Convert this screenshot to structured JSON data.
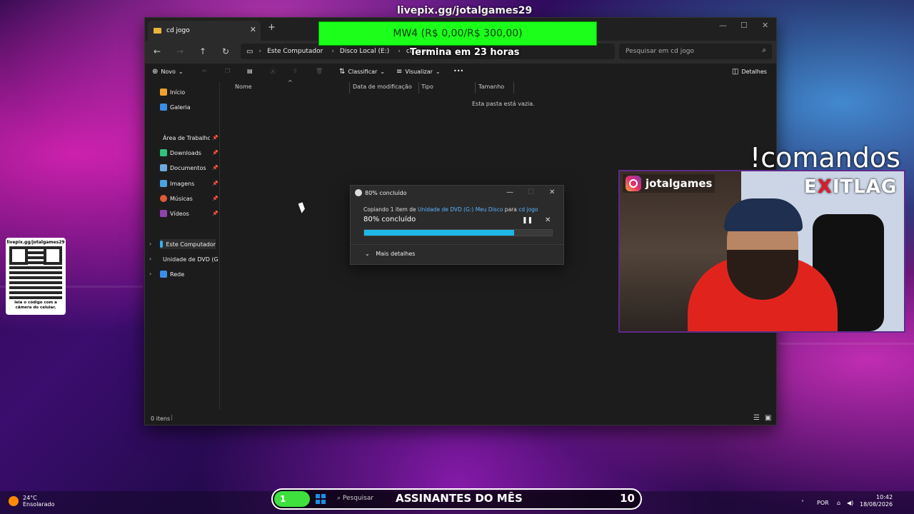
{
  "overlay": {
    "livepix_url": "livepix.gg/jotalgames29",
    "goal_text": "MW4 (R$ 0,00/R$ 300,00)",
    "goal_sub": "Termina em 23 horas",
    "commands": "!comandos",
    "instagram": "jotalgames",
    "brand_left": "E",
    "brand_x": "X",
    "brand_right": "ITLAG",
    "qr_top": "livepix.gg/jotalgames29",
    "qr_bottom": "leia o código com a câmera do celular."
  },
  "explorer": {
    "tab_title": "cd jogo",
    "new_tab": "+",
    "breadcrumbs": [
      "Este Computador",
      "Disco Local (E:)",
      "cd jogo"
    ],
    "search_placeholder": "Pesquisar em cd jogo",
    "toolbar": {
      "new": "Novo",
      "sort": "Classificar",
      "view": "Visualizar",
      "more": "•••",
      "details": "Detalhes"
    },
    "sidebar": {
      "home": "Início",
      "gallery": "Galeria",
      "desktop": "Área de Trabalho",
      "downloads": "Downloads",
      "documents": "Documentos",
      "images": "Imagens",
      "music": "Músicas",
      "videos": "Vídeos",
      "this_pc": "Este Computador",
      "dvd": "Unidade de DVD (G:)",
      "network": "Rede"
    },
    "columns": [
      "Nome",
      "Data de modificação",
      "Tipo",
      "Tamanho"
    ],
    "empty_message": "Esta pasta está vazia.",
    "status_items": "0 itens"
  },
  "copy_dialog": {
    "title": "80% concluído",
    "line_prefix": "Copiando 1 item de ",
    "source": "Unidade de DVD (G:) Meu Disco",
    "line_mid": " para ",
    "destination": "cd jogo",
    "percent_text": "80% concluído",
    "progress": 0.8,
    "more_details": "Mais detalhes"
  },
  "taskbar": {
    "temp": "24°C",
    "weather": "Ensolarado",
    "subs_count_left": "1",
    "search": "Pesquisar",
    "subs_label": "ASSINANTES DO MÊS",
    "subs_count": "10",
    "lang": "POR",
    "time": "10:42",
    "date": "18/08/2026"
  }
}
